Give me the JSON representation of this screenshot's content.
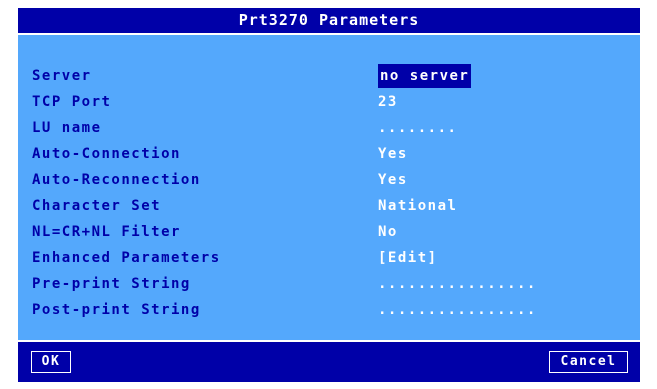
{
  "dialog": {
    "title": "Prt3270 Parameters"
  },
  "fields": [
    {
      "label": "Server",
      "value": "no server",
      "selected": true
    },
    {
      "label": "TCP Port",
      "value": "23"
    },
    {
      "label": "LU name",
      "value": "........"
    },
    {
      "label": "Auto-Connection",
      "value": "Yes"
    },
    {
      "label": "Auto-Reconnection",
      "value": "Yes"
    },
    {
      "label": "Character Set",
      "value": "National"
    },
    {
      "label": "NL=CR+NL Filter",
      "value": "No"
    },
    {
      "label": "Enhanced Parameters",
      "value": "[Edit]"
    },
    {
      "label": "Pre-print String",
      "value": "................"
    },
    {
      "label": "Post-print String",
      "value": "................"
    }
  ],
  "buttons": {
    "ok": "OK",
    "cancel": "Cancel"
  },
  "colors": {
    "panel": "#54a8fc",
    "titlebar": "#0000a8",
    "label_text": "#0000a8",
    "value_text": "#ffffff",
    "selection": "#0000a8"
  }
}
